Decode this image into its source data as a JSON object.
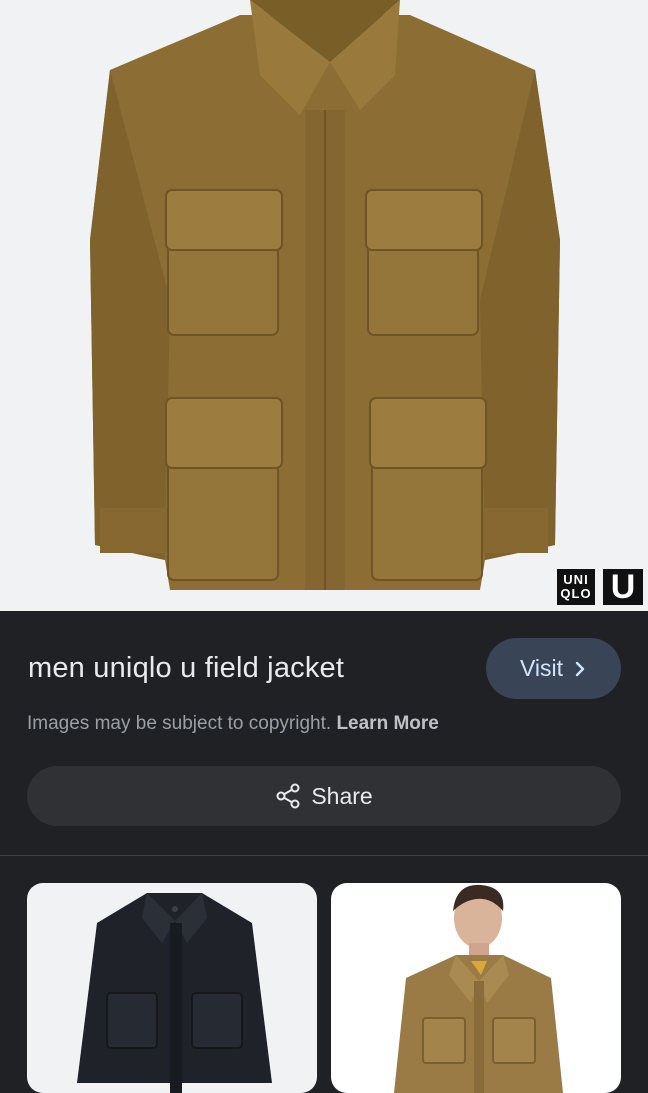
{
  "result": {
    "title": "men uniqlo u field jacket",
    "visit_label": "Visit",
    "copyright_text": "Images may be subject to copyright.",
    "learn_more_label": "Learn More",
    "share_label": "Share"
  },
  "brand": {
    "uniqlo_line1": "UNI",
    "uniqlo_line2": "QLO",
    "u_mark": "U"
  },
  "colors": {
    "background": "#202124",
    "jacket_olive": "#8c6d33",
    "visit_button": "#394457",
    "share_button": "#303134"
  }
}
